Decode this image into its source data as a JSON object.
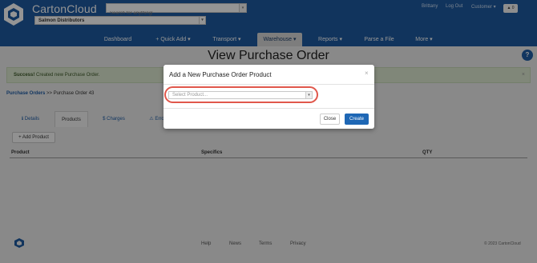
{
  "header": {
    "brand": "CartonCloud",
    "search_placeholder": "Search for anything!",
    "company": "Salmon Distributors",
    "user_links": {
      "user": "Brittany",
      "logout": "Log Out",
      "customer": "Customer ▾",
      "cart": "▲ 0"
    }
  },
  "nav": [
    {
      "label": "Dashboard"
    },
    {
      "label": "+ Quick Add ▾"
    },
    {
      "label": "Transport ▾"
    },
    {
      "label": "Warehouse ▾"
    },
    {
      "label": "Reports ▾"
    },
    {
      "label": "Parse a File"
    },
    {
      "label": "More ▾"
    }
  ],
  "page": {
    "title": "View Purchase Order",
    "help": "?",
    "alert_strong": "Success!",
    "alert_text": " Created new Purchase Order.",
    "alert_close": "×",
    "crumb_link": "Purchase Orders",
    "crumb_rest": " >> Purchase Order 43",
    "tabs": [
      {
        "label": "ℹ Details"
      },
      {
        "label": "Products"
      },
      {
        "label": "$ Charges"
      },
      {
        "label": "⚠ Errors"
      }
    ],
    "add_product": "+ Add Product",
    "columns": [
      "Product",
      "Specifics",
      "QTY"
    ]
  },
  "footer": {
    "links": [
      "Help",
      "News",
      "Terms",
      "Privacy"
    ],
    "copyright": "© 2023 CartonCloud"
  },
  "modal": {
    "title": "Add a New Purchase Order Product",
    "close_x": "×",
    "select_placeholder": "Select Product...",
    "close_label": "Close",
    "create_label": "Create"
  },
  "colors": {
    "header_bg": "#1e5aa0",
    "primary_button": "#1e67b5",
    "highlight": "#e0574b"
  }
}
